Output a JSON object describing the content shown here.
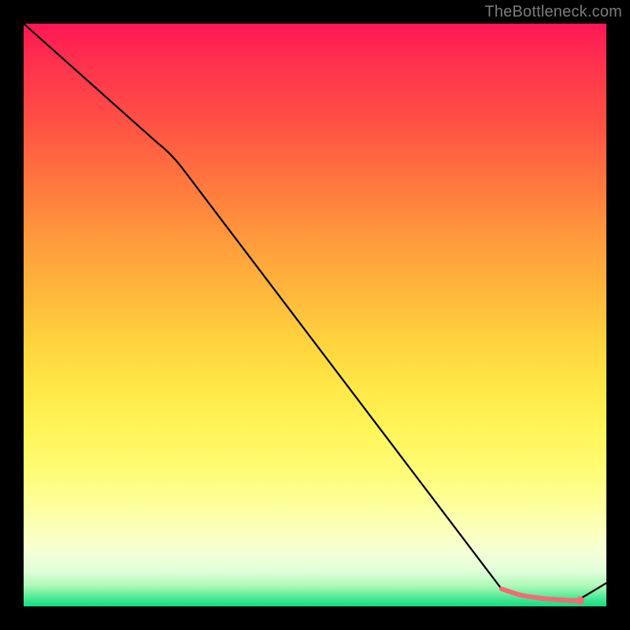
{
  "attribution": "TheBottleneck.com",
  "chart_data": {
    "type": "line",
    "title": "",
    "xlabel": "",
    "ylabel": "",
    "xlim": [
      0,
      100
    ],
    "ylim": [
      0,
      100
    ],
    "series": [
      {
        "name": "bottleneck-curve",
        "color": "#000000",
        "x": [
          0,
          25,
          82,
          86,
          92,
          95,
          100
        ],
        "y": [
          100,
          78,
          3,
          1.5,
          1,
          1,
          4
        ]
      }
    ],
    "markers": [
      {
        "name": "red-segment",
        "color": "#f36a75",
        "x": [
          82,
          83.5,
          85,
          86.5,
          88,
          89.5,
          91,
          92.5,
          94,
          95.5
        ],
        "y": [
          3,
          2.5,
          2,
          1.7,
          1.5,
          1.3,
          1.2,
          1.1,
          1.0,
          1.0
        ],
        "style": "dot",
        "size": 4.5
      }
    ]
  }
}
